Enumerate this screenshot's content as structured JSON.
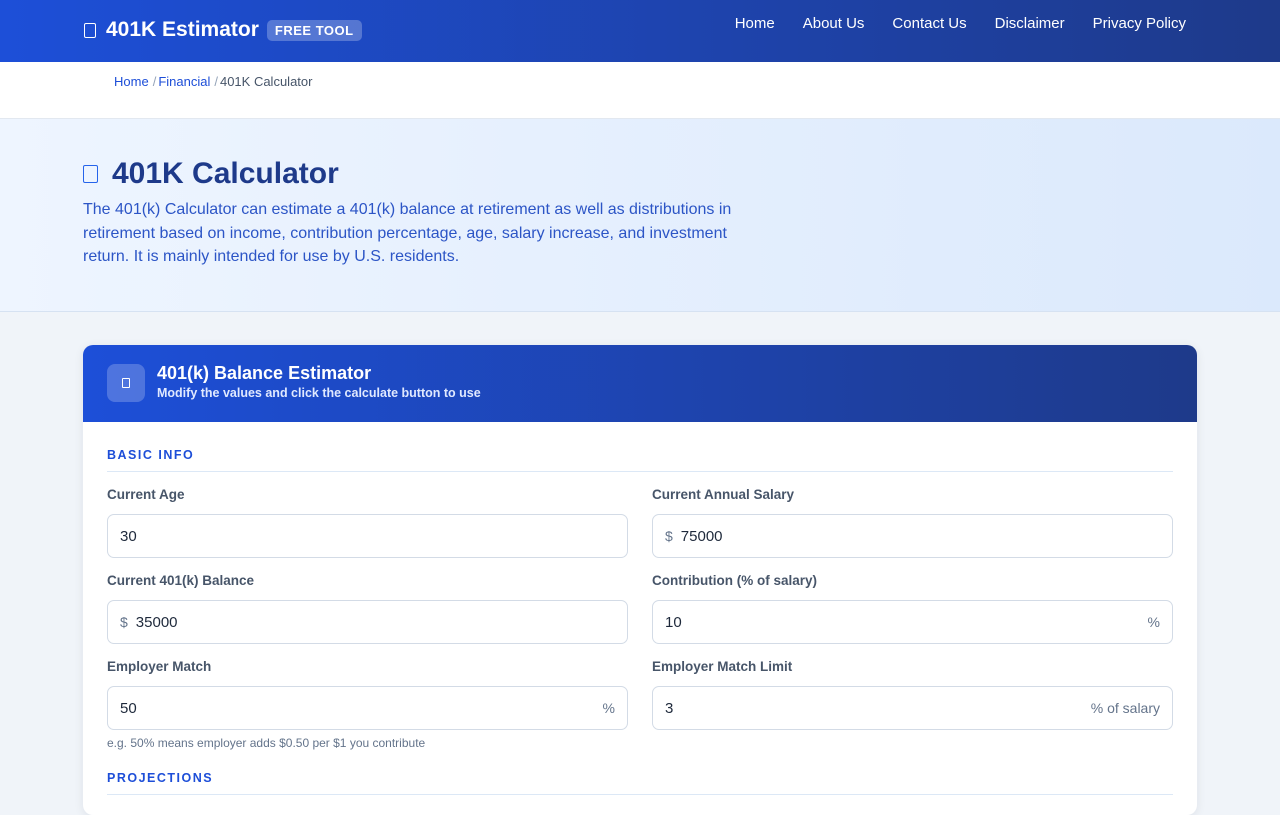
{
  "topnav": {
    "brand_name": "401K Estimator",
    "badge": "FREE TOOL",
    "links": [
      {
        "label": "Home"
      },
      {
        "label": "About Us"
      },
      {
        "label": "Contact Us"
      },
      {
        "label": "Disclaimer"
      },
      {
        "label": "Privacy Policy"
      }
    ]
  },
  "breadcrumb": {
    "home": "Home",
    "financial": "Financial",
    "current": "401K Calculator",
    "separator": "/"
  },
  "hero": {
    "title": "401K Calculator",
    "description": "The 401(k) Calculator can estimate a 401(k) balance at retirement as well as distributions in retirement based on income, contribution percentage, age, salary increase, and investment return. It is mainly intended for use by U.S. residents."
  },
  "card": {
    "title": "401(k) Balance Estimator",
    "subtitle": "Modify the values and click the calculate button to use",
    "sections": {
      "basic": "BASIC INFO",
      "projections": "PROJECTIONS"
    },
    "fields": {
      "current_age": {
        "label": "Current Age",
        "value": "30"
      },
      "annual_salary": {
        "label": "Current Annual Salary",
        "prefix": "$",
        "value": "75000"
      },
      "balance": {
        "label": "Current 401(k) Balance",
        "prefix": "$",
        "value": "35000"
      },
      "contribution": {
        "label": "Contribution (% of salary)",
        "value": "10",
        "suffix": "%"
      },
      "employer_match": {
        "label": "Employer Match",
        "value": "50",
        "suffix": "%",
        "hint": "e.g. 50% means employer adds $0.50 per $1 you contribute"
      },
      "match_limit": {
        "label": "Employer Match Limit",
        "value": "3",
        "suffix": "% of salary"
      }
    }
  }
}
